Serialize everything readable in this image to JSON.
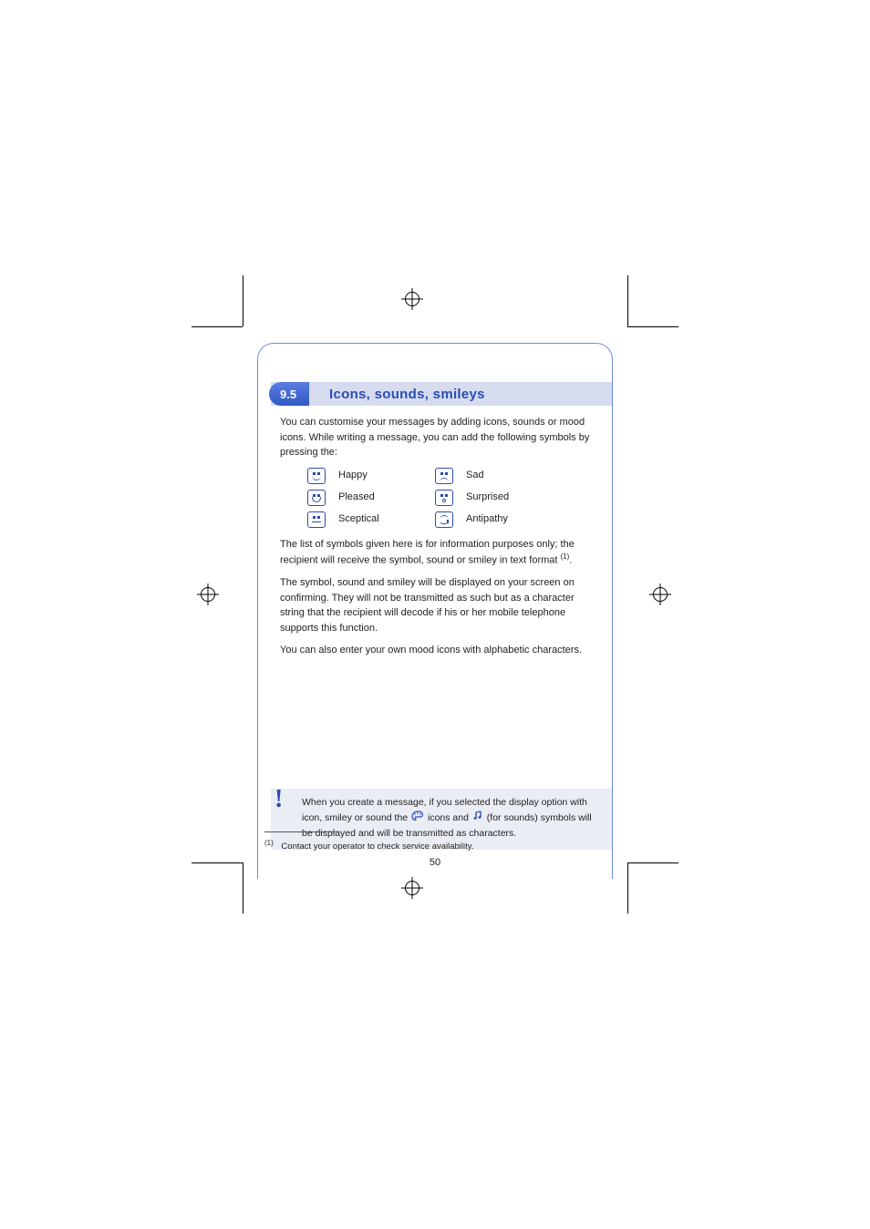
{
  "section": {
    "number": "9.5",
    "title": "Icons, sounds, smileys"
  },
  "paragraphs": {
    "p1": "You can customise your messages by adding icons, sounds or mood icons. While writing a message, you can add the following symbols by pressing the:",
    "p2a": "The list of symbols given here is for information purposes only; the recipient will receive the symbol, sound or smiley in text format ",
    "p2b": "(1)",
    "p2c": ".",
    "p3": "The symbol, sound and smiley will be displayed on your screen on confirming. They will not be transmitted as such but as a character string that the recipient will decode if his or her mobile telephone supports this function.",
    "p4": "You can also enter your own mood icons with alphabetic characters."
  },
  "smileys": [
    {
      "label": "Happy",
      "style": "smile"
    },
    {
      "label": "Sad",
      "style": "sad"
    },
    {
      "label": "Pleased",
      "style": "bigsmile"
    },
    {
      "label": "Surprised",
      "style": "o"
    },
    {
      "label": "Sceptical",
      "style": "flat"
    },
    {
      "label": "Antipathy",
      "style": "anti"
    }
  ],
  "note": {
    "t1": "When you create a message, if you selected the display option with icon, smiley or sound the ",
    "t2": " icons and ",
    "t3": " (for sounds) symbols will be displayed and will be transmitted as characters."
  },
  "footnote": "(1) Contact your operator to check service availability.",
  "page_number": "50"
}
